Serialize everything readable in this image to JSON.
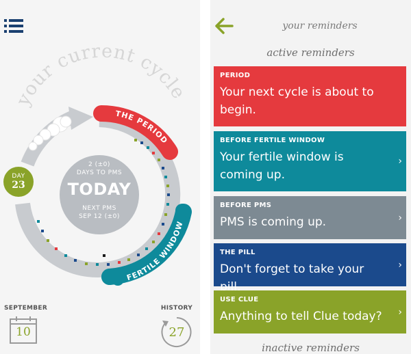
{
  "cycle": {
    "arc_title": "your current cycle",
    "period_label": "THE PERIOD",
    "fertile_label": "FERTILE WINDOW",
    "pms_count": "2 (±0)",
    "pms_label": "DAYS TO PMS",
    "today_label": "TODAY",
    "next_pms_label": "NEXT PMS",
    "next_pms_date": "SEP 12 (±0)",
    "day_label": "DAY",
    "day_number": "23",
    "month_label": "SEPTEMBER",
    "calendar_day": "10",
    "history_label": "HISTORY",
    "history_count": "27"
  },
  "reminders_screen": {
    "title": "your reminders",
    "active_header": "active reminders",
    "inactive_header": "inactive reminders",
    "items": [
      {
        "title": "PERIOD",
        "text": "Your next cycle is about to begin.",
        "color": "#e53a3e"
      },
      {
        "title": "BEFORE FERTILE WINDOW",
        "text": "Your fertile window is coming up.",
        "color": "#0e8a9b"
      },
      {
        "title": "BEFORE PMS",
        "text": "PMS is coming up.",
        "color": "#7d8a93"
      },
      {
        "title": "THE PILL",
        "text": "Don't forget to take your pill.",
        "color": "#1b4a8c"
      },
      {
        "title": "USE CLUE",
        "text": "Anything to tell Clue today?",
        "color": "#8aa329"
      }
    ],
    "chevron": "›"
  },
  "colors": {
    "accent_green": "#8aa329",
    "period_red": "#e53a3e",
    "fertile_teal": "#0e8a9b",
    "ring_gray": "#c8cbcf"
  }
}
